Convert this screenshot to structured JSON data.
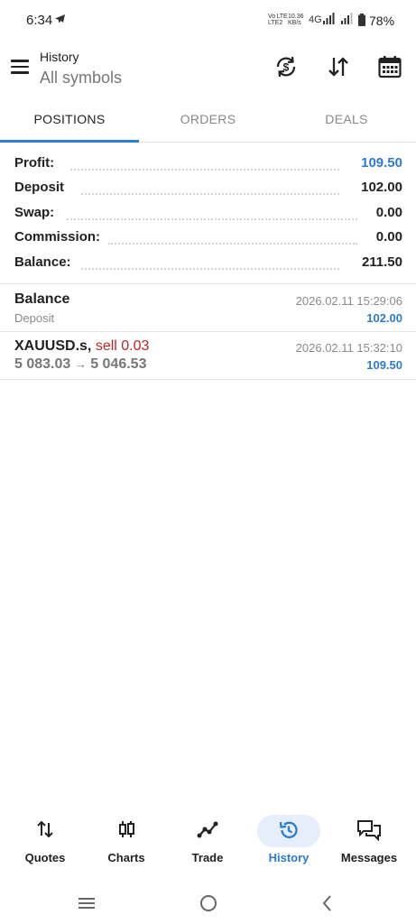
{
  "status_bar": {
    "time": "6:34",
    "net_top": "Vo LTE",
    "net_bottom": "LTE2",
    "rate_top": "10.36",
    "rate_bottom": "KB/s",
    "network": "4G",
    "battery": "78%"
  },
  "header": {
    "title": "History",
    "subtitle": "All symbols",
    "icons": [
      "currency-refresh-icon",
      "sort-icon",
      "calendar-icon"
    ]
  },
  "tabs": [
    {
      "label": "POSITIONS",
      "active": true
    },
    {
      "label": "ORDERS",
      "active": false
    },
    {
      "label": "DEALS",
      "active": false
    }
  ],
  "summary": [
    {
      "label": "Profit:",
      "value": "109.50",
      "highlight": true
    },
    {
      "label": "Deposit",
      "value": "102.00",
      "highlight": false
    },
    {
      "label": "Swap:",
      "value": "0.00",
      "highlight": false
    },
    {
      "label": "Commission:",
      "value": "0.00",
      "highlight": false
    },
    {
      "label": "Balance:",
      "value": "211.50",
      "highlight": false
    }
  ],
  "records": [
    {
      "title": "Balance",
      "subtitle": "Deposit",
      "datetime": "2026.02.11 15:29:06",
      "amount": "102.00"
    },
    {
      "symbol": "XAUUSD.s,",
      "side": "sell 0.03",
      "open_price": "5 083.03",
      "arrow": "→",
      "close_price": "5 046.53",
      "datetime": "2026.02.11 15:32:10",
      "amount": "109.50"
    }
  ],
  "bottom_nav": [
    {
      "label": "Quotes",
      "icon": "quotes-arrows-icon"
    },
    {
      "label": "Charts",
      "icon": "candlestick-icon"
    },
    {
      "label": "Trade",
      "icon": "trade-line-icon"
    },
    {
      "label": "History",
      "icon": "history-clock-icon",
      "active": true
    },
    {
      "label": "Messages",
      "icon": "messages-icon"
    }
  ],
  "colors": {
    "accent": "#2a7bd5",
    "sell": "#c22323",
    "active_pill": "#e6eefb"
  }
}
